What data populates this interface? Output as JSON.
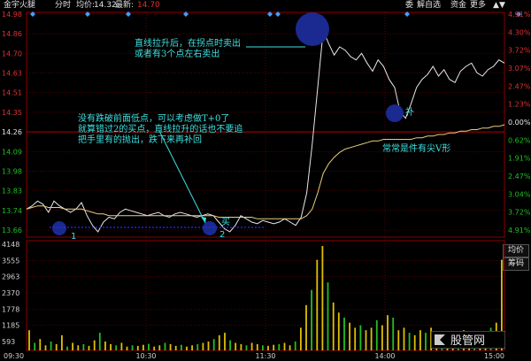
{
  "header": {
    "stock_name": "金宇火腿",
    "chart_mode": "分时",
    "avg_label": "均价:",
    "avg_value": "14.32",
    "latest_label": "最新:",
    "latest_value": "14.70",
    "buttons": [
      "委",
      "解自选",
      "资金",
      "更多"
    ]
  },
  "side_buttons": [
    "均价",
    "筹码"
  ],
  "price_axis": {
    "labels": [
      "14.98",
      "14.86",
      "14.70",
      "14.63",
      "14.51",
      "14.35",
      "14.26",
      "14.09",
      "13.98",
      "13.83",
      "13.74",
      "13.66"
    ],
    "pct_labels": [
      "4.91%",
      "4.30%",
      "3.72%",
      "3.07%",
      "2.47%",
      "1.23%",
      "0.00%",
      "0.62%",
      "1.91%",
      "2.47%",
      "3.04%",
      "3.72%",
      "4.91%"
    ]
  },
  "volume_axis": {
    "labels": [
      "4148",
      "3555",
      "2963",
      "2370",
      "1778",
      "1185",
      "593"
    ]
  },
  "time_axis": {
    "labels": [
      "09:30",
      "10:30",
      "11:30",
      "14:00",
      "15:00"
    ]
  },
  "annotations": {
    "top_note_line1": "直线拉升后，在拐点时卖出",
    "top_note_line2": "或者有3个点左右卖出",
    "left_note_line1": "没有跌破前面低点，可以考虑做T+0了",
    "left_note_line2": "就算错过2的买点，直线拉升的话也不要追",
    "left_note_line3": "把手里有的抛出，跌下来再补回",
    "buy_label": "买",
    "add_label": "补",
    "v_note": "常常是件有尖V形",
    "point1": "1",
    "point2": "2"
  },
  "watermark": "股管网",
  "colors": {
    "price_line": "#e8e8e8",
    "avg_line": "#e8d080",
    "up": "#e03030",
    "down": "#20c020",
    "annotation": "#40e0e0",
    "circle": "#1a2a90",
    "grid": "#8a0000",
    "volume": "#e0c000"
  },
  "chart_data": [
    {
      "type": "line",
      "title": "",
      "series": [
        {
          "name": "",
          "values": [
            13.8,
            13.82,
            13.85,
            13.83,
            13.78,
            13.85,
            13.82,
            13.8,
            13.78,
            13.8,
            13.84,
            13.76,
            13.7,
            13.66,
            13.72,
            13.75,
            13.74,
            13.78,
            13.8,
            13.79,
            13.78,
            13.77,
            13.76,
            13.77,
            13.78,
            13.76,
            13.75,
            13.77,
            13.78,
            13.77,
            13.76,
            13.75,
            13.76,
            13.77,
            13.76,
            13.72,
            13.68,
            13.66,
            13.7,
            13.76,
            13.74,
            13.72,
            13.71,
            13.73,
            13.72,
            13.71,
            13.72,
            13.74,
            13.72,
            13.7,
            13.75,
            13.9,
            14.2,
            14.55,
            14.9,
            14.82,
            14.75,
            14.8,
            14.78,
            14.74,
            14.72,
            14.76,
            14.7,
            14.65,
            14.72,
            14.68,
            14.6,
            14.55,
            14.4,
            14.36,
            14.45,
            14.55,
            14.6,
            14.63,
            14.68,
            14.62,
            14.66,
            14.6,
            14.58,
            14.65,
            14.68,
            14.7,
            14.64,
            14.62,
            14.66,
            14.68,
            14.72,
            14.7
          ]
        },
        {
          "name": "",
          "values": [
            13.8,
            13.81,
            13.82,
            13.82,
            13.81,
            13.81,
            13.81,
            13.8,
            13.8,
            13.8,
            13.8,
            13.79,
            13.78,
            13.77,
            13.77,
            13.76,
            13.76,
            13.76,
            13.76,
            13.76,
            13.76,
            13.76,
            13.76,
            13.76,
            13.76,
            13.76,
            13.76,
            13.76,
            13.76,
            13.76,
            13.76,
            13.76,
            13.76,
            13.76,
            13.76,
            13.75,
            13.75,
            13.75,
            13.75,
            13.75,
            13.75,
            13.75,
            13.74,
            13.74,
            13.74,
            13.74,
            13.74,
            13.74,
            13.74,
            13.74,
            13.74,
            13.76,
            13.8,
            13.9,
            14.02,
            14.08,
            14.12,
            14.15,
            14.17,
            14.18,
            14.19,
            14.2,
            14.21,
            14.22,
            14.22,
            14.23,
            14.23,
            14.23,
            14.23,
            14.23,
            14.23,
            14.24,
            14.24,
            14.25,
            14.25,
            14.26,
            14.26,
            14.27,
            14.27,
            14.28,
            14.28,
            14.29,
            14.29,
            14.3,
            14.3,
            14.31,
            14.31,
            14.32
          ]
        }
      ],
      "ylim": [
        13.66,
        14.98
      ]
    },
    {
      "type": "bar",
      "title": "",
      "values": [
        800,
        300,
        450,
        200,
        350,
        250,
        600,
        150,
        300,
        200,
        250,
        180,
        400,
        700,
        350,
        250,
        200,
        300,
        150,
        200,
        180,
        220,
        260,
        150,
        200,
        300,
        250,
        180,
        220,
        150,
        200,
        250,
        300,
        350,
        450,
        600,
        700,
        400,
        300,
        250,
        200,
        300,
        250,
        200,
        180,
        220,
        250,
        300,
        200,
        350,
        900,
        1800,
        2400,
        3600,
        4148,
        2700,
        1900,
        1500,
        1300,
        1100,
        900,
        1000,
        800,
        900,
        1200,
        1000,
        1400,
        1300,
        800,
        900,
        700,
        600,
        800,
        700,
        900,
        500,
        600,
        700,
        500,
        600,
        800,
        700,
        500,
        600,
        700,
        900,
        1100,
        3600
      ],
      "ylim": [
        0,
        4148
      ]
    }
  ]
}
